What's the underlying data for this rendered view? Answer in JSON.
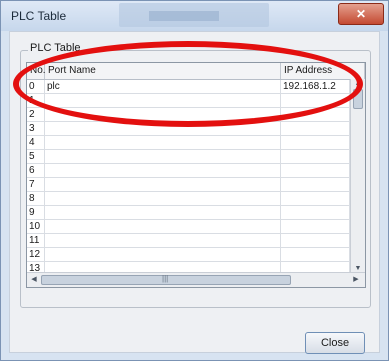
{
  "window": {
    "title": "PLC Table",
    "close_glyph": "✕"
  },
  "group": {
    "label": "PLC Table"
  },
  "table": {
    "columns": [
      "No.",
      "Port Name",
      "IP Address"
    ],
    "rows": [
      {
        "no": "0",
        "port_name": "plc",
        "ip": "192.168.1.2"
      },
      {
        "no": "1",
        "port_name": "",
        "ip": ""
      },
      {
        "no": "2",
        "port_name": "",
        "ip": ""
      },
      {
        "no": "3",
        "port_name": "",
        "ip": ""
      },
      {
        "no": "4",
        "port_name": "",
        "ip": ""
      },
      {
        "no": "5",
        "port_name": "",
        "ip": ""
      },
      {
        "no": "6",
        "port_name": "",
        "ip": ""
      },
      {
        "no": "7",
        "port_name": "",
        "ip": ""
      },
      {
        "no": "8",
        "port_name": "",
        "ip": ""
      },
      {
        "no": "9",
        "port_name": "",
        "ip": ""
      },
      {
        "no": "10",
        "port_name": "",
        "ip": ""
      },
      {
        "no": "11",
        "port_name": "",
        "ip": ""
      },
      {
        "no": "12",
        "port_name": "",
        "ip": ""
      },
      {
        "no": "13",
        "port_name": "",
        "ip": ""
      }
    ]
  },
  "buttons": {
    "close": "Close"
  },
  "icons": {
    "scroll_up": "up-arrow-icon",
    "scroll_down": "down-arrow-icon",
    "scroll_left": "left-arrow-icon",
    "scroll_right": "right-arrow-icon"
  },
  "colors": {
    "annotation": "#e3100f",
    "accent": "#6f8fb6"
  }
}
